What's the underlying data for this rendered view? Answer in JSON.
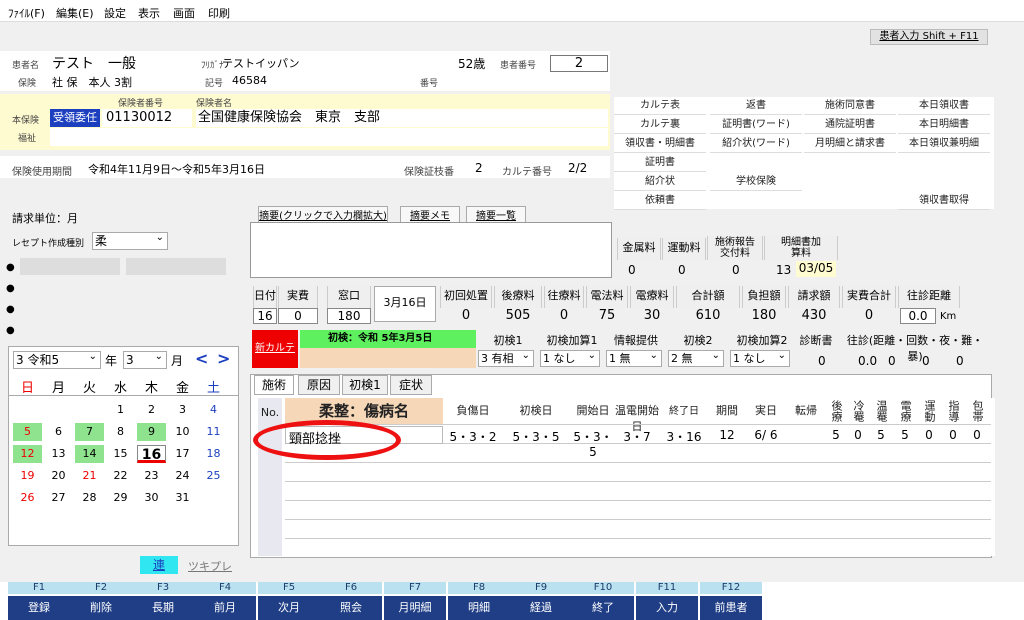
{
  "menu": {
    "file": "ﾌｧｲﾙ(F)",
    "edit": "編集(E)",
    "settings": "設定",
    "view": "表示",
    "screen": "画面",
    "print": "印刷"
  },
  "top_link": "患者入力 Shift + F11",
  "patient": {
    "name_label": "患者名",
    "name": "テスト　一般",
    "kana_label": "ﾌﾘｶﾞﾅ",
    "kana": "テストイッパン",
    "age": "52歳",
    "id_label": "患者番号",
    "id": "2",
    "ins_label": "保険",
    "ins": "社 保　本人 3割",
    "kigo_label": "記号",
    "kigo": "46584",
    "bango_label": "番号"
  },
  "insurance": {
    "main_label": "本保険",
    "status": "受領委任",
    "welfare_label": "福祉",
    "insurer_no_label": "保険者番号",
    "insurer_no": "01130012",
    "insurer_name_label": "保険者名",
    "insurer_name": "全国健康保険協会　東京　支部"
  },
  "period": {
    "label": "保険使用期間",
    "value": "令和4年11月9日～令和5年3月16日",
    "card_label": "保険証枝番",
    "card": "2",
    "karte_label": "カルテ番号",
    "karte": "2/2"
  },
  "docs": [
    "カルテ表",
    "返書",
    "施術同意書",
    "本日領収書",
    "カルテ裏",
    "証明書(ワード)",
    "通院証明書",
    "本日明細書",
    "領収書・明細書",
    "紹介状(ワード)",
    "月明細と請求書",
    "本日領収兼明細",
    "証明書",
    "紹介状",
    "学校保険",
    "依頼書",
    "領収書取得"
  ],
  "billing": {
    "unit_label": "請求単位：月",
    "receipt_label": "レセプト作成種別",
    "receipt_type": "柔"
  },
  "memo_tabs": [
    "摘要(クリックで入力欄拡大)",
    "摘要メモ",
    "摘要一覧"
  ],
  "fees_top": {
    "headers": [
      "金属料",
      "運動料",
      "施術報告交付料",
      "明細書加算料"
    ],
    "values": [
      "0",
      "0",
      "0",
      "13",
      "03/05"
    ]
  },
  "fees": {
    "headers": [
      "日付",
      "実費",
      "窓口",
      "初回処置",
      "後療料",
      "往療料",
      "電法料",
      "電療料",
      "合計額",
      "負担額",
      "請求額",
      "実費合計",
      "往診距離"
    ],
    "values": [
      "16",
      "0",
      "180",
      "3月16日",
      "0",
      "505",
      "0",
      "75",
      "30",
      "610",
      "180",
      "430",
      "0",
      "0.0"
    ],
    "km": "Km"
  },
  "shoken": {
    "new_karte": "新カルテ",
    "label": "初検：令和 5年3月5日",
    "headers": [
      "初検1",
      "初検加算1",
      "情報提供",
      "初検2",
      "初検加算2",
      "診断書",
      "往診(距離・回数・夜・難・暴)"
    ],
    "selects": [
      "3 有相",
      "1 なし",
      "1 無",
      "2 無",
      "1 なし"
    ],
    "values": [
      "0",
      "0.0",
      "0",
      "0",
      "0"
    ]
  },
  "cal": {
    "era": "3 令和5",
    "year_label": "年",
    "month": "3",
    "month_label": "月",
    "prev": "<",
    "next": ">",
    "dow": [
      "日",
      "月",
      "火",
      "水",
      "木",
      "金",
      "土"
    ],
    "days": [
      "",
      "",
      "",
      "1",
      "2",
      "3",
      "4",
      "5",
      "6",
      "7",
      "8",
      "9",
      "10",
      "11",
      "12",
      "13",
      "14",
      "15",
      "16",
      "17",
      "18",
      "19",
      "20",
      "21",
      "22",
      "23",
      "24",
      "25",
      "26",
      "27",
      "28",
      "29",
      "30",
      "31"
    ],
    "ren": "連",
    "tsukiple": "ツキプレ"
  },
  "tabs": [
    "施術",
    "原因",
    "初検1",
    "症状"
  ],
  "table": {
    "headers": [
      "No.",
      "柔整：傷病名",
      "負傷日",
      "初検日",
      "開始日",
      "温電開始日",
      "終了日",
      "期間",
      "実日",
      "転帰",
      "後療",
      "冷罨",
      "温罨",
      "電療",
      "運動",
      "指導",
      "包帯"
    ],
    "row": {
      "name": "頸部捻挫",
      "injury": "5・3・2",
      "first": "5・3・5",
      "start": "5・3・5",
      "warm": "3・7",
      "end": "3・16",
      "period": "12",
      "days": "6/ 6",
      "c1": "5",
      "c2": "0",
      "c3": "5",
      "c4": "5",
      "c5": "0",
      "c6": "0",
      "c7": "0"
    }
  },
  "fkeys": [
    [
      "F1",
      "登録"
    ],
    [
      "F2",
      "削除"
    ],
    [
      "F3",
      "長期"
    ],
    [
      "F4",
      "前月"
    ],
    [
      "F5",
      "次月"
    ],
    [
      "F6",
      "照会"
    ],
    [
      "F7",
      "月明細"
    ],
    [
      "F8",
      "明細"
    ],
    [
      "F9",
      "経過"
    ],
    [
      "F10",
      "終了"
    ],
    [
      "F11",
      "入力"
    ],
    [
      "F12",
      "前患者"
    ]
  ]
}
